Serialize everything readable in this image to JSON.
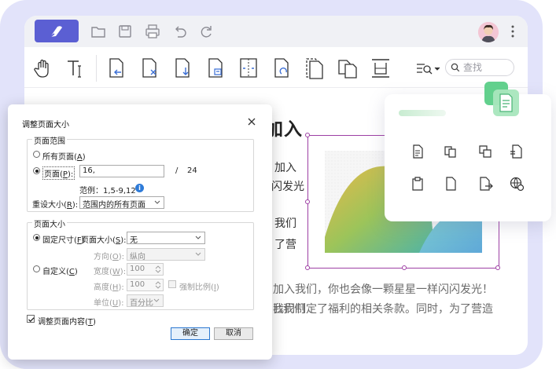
{
  "search": {
    "placeholder": "查找"
  },
  "document": {
    "heading_fragment": "加入",
    "lines_right": [
      "加入",
      "闪发光",
      "我们",
      "了营"
    ],
    "bottom_line1": "加入我们，你也会像一颗星星一样闪闪发光！",
    "bottom_line2": "我们制定了福利的相关条款。同时，为了营造",
    "bottom_frag1": "匕我们"
  },
  "dialog": {
    "title": "调整页面大小",
    "page_range": {
      "group_label": "页面范围",
      "all_pages": "所有页面",
      "all_pages_key": "A",
      "pages": "页面",
      "pages_key": "P",
      "pages_value": "16,",
      "total_sep": "/",
      "total_pages": "24",
      "example": "范例：1,5-9,12",
      "info": "i",
      "resize_label": "重设大小",
      "resize_key": "R",
      "resize_value": "范围内的所有页面"
    },
    "page_size": {
      "group_label": "页面大小",
      "fixed": "固定尺寸",
      "fixed_key": "F",
      "size_label": "页面大小",
      "size_key": "S",
      "size_value": "无",
      "orientation_label": "方向",
      "orientation_key": "O",
      "orientation_value": "纵向",
      "custom": "自定义",
      "custom_key": "C",
      "width_label": "宽度",
      "width_key": "W",
      "width_value": "100",
      "height_label": "高度",
      "height_key": "H",
      "height_value": "100",
      "ratio_label": "强制比例",
      "ratio_key": "I",
      "unit_label": "单位",
      "unit_key": "U",
      "unit_value": "百分比"
    },
    "adjust_content": "调整页面内容",
    "adjust_content_key": "T",
    "ok": "确定",
    "cancel": "取消"
  },
  "colors": {
    "frame_bg": "#e2e3fa",
    "logo_bg": "#5b5fd3",
    "selection": "#9d3fa4",
    "accent_green": "#5cc98a"
  }
}
